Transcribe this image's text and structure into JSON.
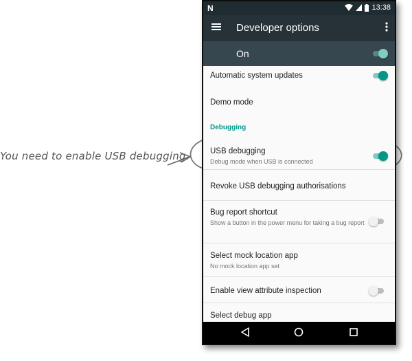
{
  "annotation": {
    "text": "You need to enable USB debugging."
  },
  "status_bar": {
    "time": "13:38",
    "notification_icon": "N"
  },
  "app_bar": {
    "title": "Developer options",
    "menu_icon": "hamburger-menu-icon",
    "more_icon": "more-vert-icon"
  },
  "master_switch": {
    "label": "On",
    "checked": true
  },
  "accent_color": "#009688",
  "items": [
    {
      "title": "Automatic system updates",
      "checked": true
    },
    {
      "title": "Demo mode"
    },
    {
      "category": "Debugging"
    },
    {
      "title": "USB debugging",
      "subtitle": "Debug mode when USB is connected",
      "checked": true
    },
    {
      "title": "Revoke USB debugging authorisations"
    },
    {
      "title": "Bug report shortcut",
      "subtitle": "Show a button in the power menu for taking a bug report",
      "checked": false
    },
    {
      "title": "Select mock location app",
      "subtitle": "No mock location app set"
    },
    {
      "title": "Enable view attribute inspection",
      "checked": false
    },
    {
      "title": "Select debug app"
    }
  ],
  "nav_bar": {
    "back_icon": "back-triangle-icon",
    "home_icon": "home-circle-icon",
    "recents_icon": "recents-square-icon"
  }
}
